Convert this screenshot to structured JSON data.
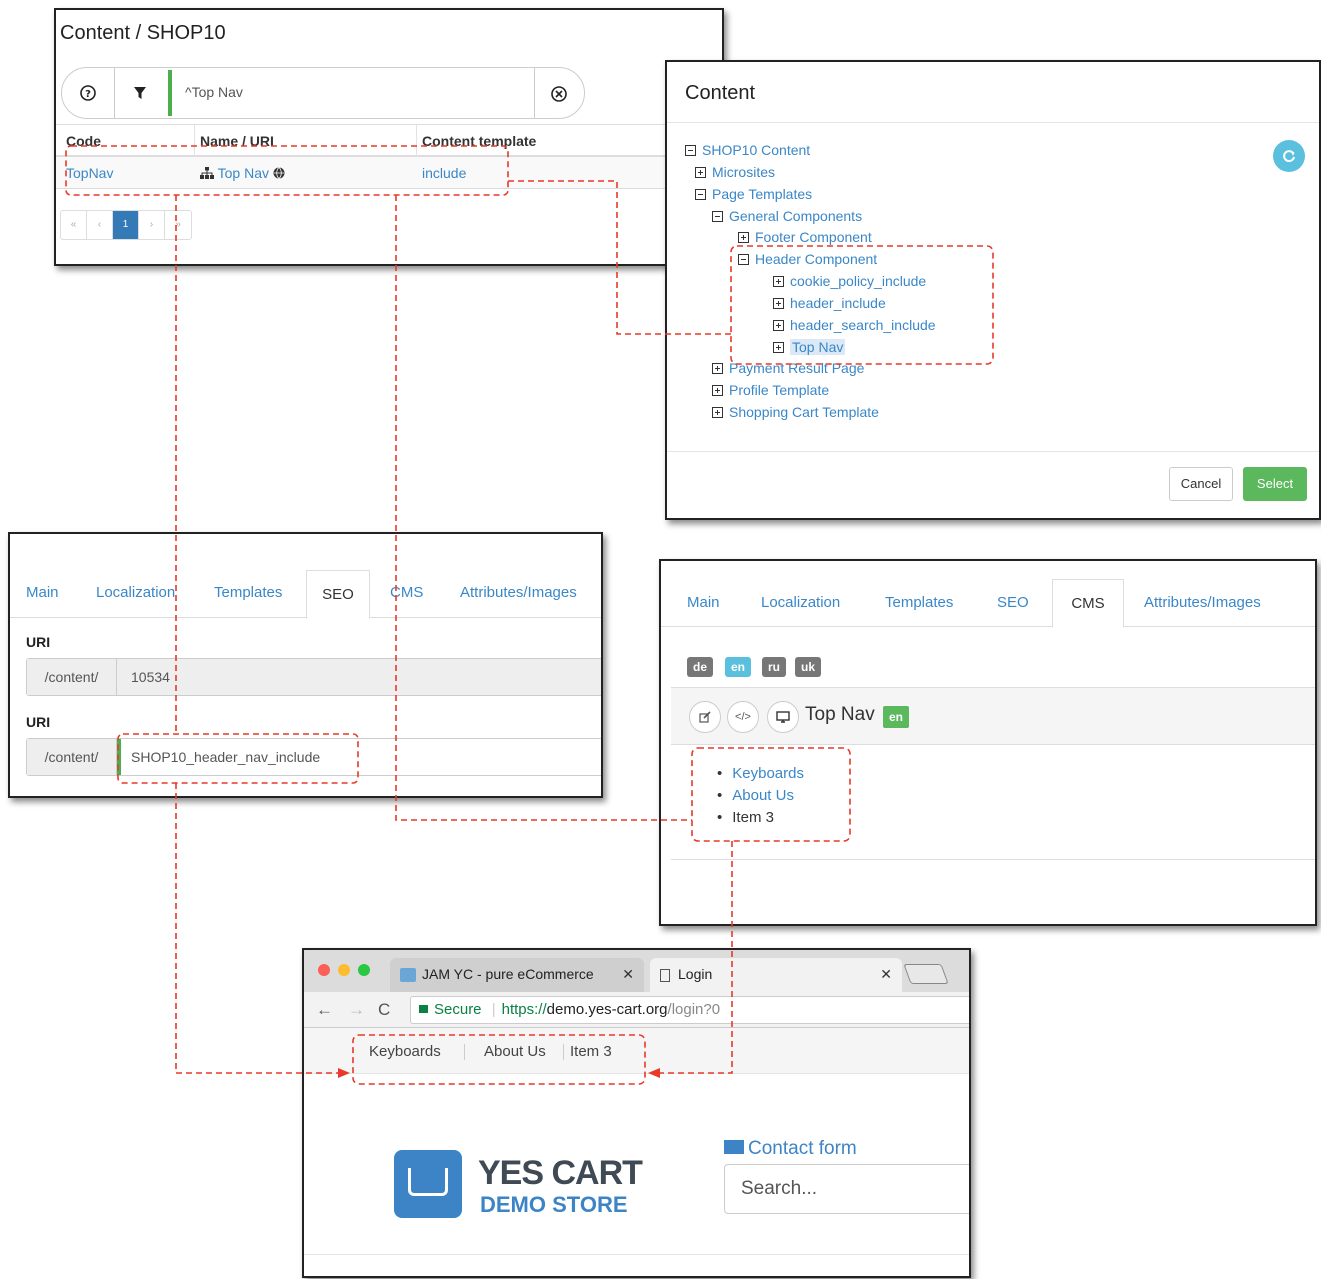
{
  "filter_panel": {
    "title": "Content / SHOP10",
    "filter_value": "^Top Nav",
    "columns": [
      "Code",
      "Name / URI",
      "Content template"
    ],
    "row": {
      "code": "TopNav",
      "name": "Top Nav",
      "template": "include"
    },
    "pager": [
      "«",
      "‹",
      "1",
      "›",
      "»"
    ]
  },
  "tree_panel": {
    "title": "Content",
    "nodes": {
      "root": "SHOP10 Content",
      "microsites": "Microsites",
      "page_templates": "Page Templates",
      "general_components": "General Components",
      "footer_component": "Footer Component",
      "header_component": "Header Component",
      "cookie_policy_include": "cookie_policy_include",
      "header_include": "header_include",
      "header_search_include": "header_search_include",
      "top_nav": "Top Nav",
      "payment_result_page": "Payment Result Page",
      "profile_template": "Profile Template",
      "shopping_cart_template": "Shopping Cart Template"
    },
    "cancel_label": "Cancel",
    "select_label": "Select"
  },
  "seo_panel": {
    "tabs": [
      "Main",
      "Localization",
      "Templates",
      "SEO",
      "CMS",
      "Attributes/Images"
    ],
    "active_tab": "SEO",
    "uri_label_1": "URI",
    "uri_prefix_1": "/content/",
    "uri_value_1": "10534",
    "uri_label_2": "URI",
    "uri_prefix_2": "/content/",
    "uri_value_2": "SHOP10_header_nav_include"
  },
  "cms_panel": {
    "tabs": [
      "Main",
      "Localization",
      "Templates",
      "SEO",
      "CMS",
      "Attributes/Images"
    ],
    "active_tab": "CMS",
    "languages": [
      "de",
      "en",
      "ru",
      "uk"
    ],
    "active_language": "en",
    "content_title": "Top Nav",
    "content_lang_badge": "en",
    "list_items": [
      "Keyboards",
      "About Us",
      "Item 3"
    ]
  },
  "browser": {
    "tab1_title": "JAM YC - pure eCommerce",
    "tab2_title": "Login",
    "secure_label": "Secure",
    "url_scheme": "https://",
    "url_host": "demo.yes-cart.org",
    "url_path": "/login?0",
    "topnav_items": [
      "Keyboards",
      "About Us",
      "Item 3"
    ],
    "logo_line1": "YES CART",
    "logo_line2": "DEMO STORE",
    "contact_label": "Contact form",
    "search_placeholder": "Search..."
  },
  "colors": {
    "link": "#3a87c8",
    "success": "#5cb85c",
    "info": "#5bc0de",
    "primary": "#337ab7",
    "callout": "#e8392a"
  }
}
